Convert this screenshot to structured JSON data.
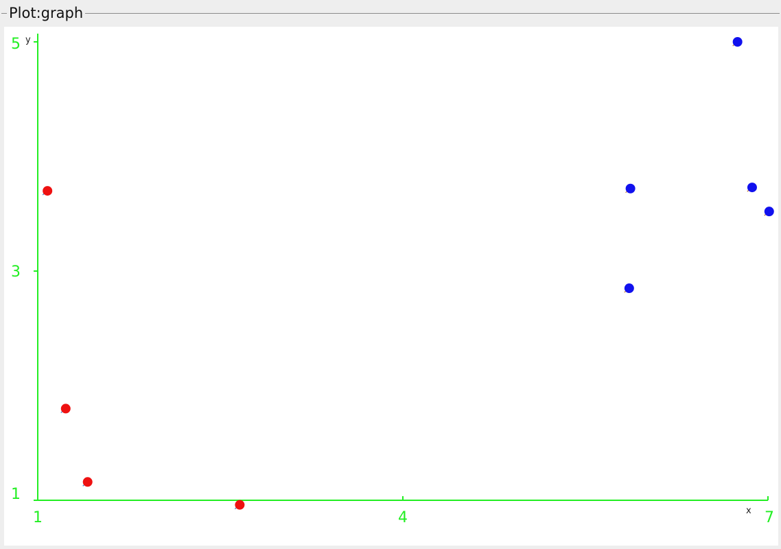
{
  "panel": {
    "title": "Plot:graph"
  },
  "chart_data": {
    "type": "scatter",
    "title": "",
    "xlabel": "x",
    "ylabel": "y",
    "xlim": [
      1,
      7
    ],
    "ylim": [
      1,
      5
    ],
    "xticks": [
      "1",
      "4",
      "7"
    ],
    "yticks": [
      "5",
      "3",
      "1"
    ],
    "grid": false,
    "series": [
      {
        "color": "#ee1111",
        "points": [
          {
            "x": 1.08,
            "y": 3.7
          },
          {
            "x": 1.23,
            "y": 1.8
          },
          {
            "x": 1.41,
            "y": 1.16
          },
          {
            "x": 2.66,
            "y": 0.96
          }
        ]
      },
      {
        "color": "#1111ee",
        "points": [
          {
            "x": 5.87,
            "y": 3.72
          },
          {
            "x": 5.86,
            "y": 2.85
          },
          {
            "x": 6.75,
            "y": 5.0
          },
          {
            "x": 6.87,
            "y": 3.73
          },
          {
            "x": 7.01,
            "y": 3.52
          }
        ]
      }
    ],
    "axis_color": "#22ee22"
  }
}
